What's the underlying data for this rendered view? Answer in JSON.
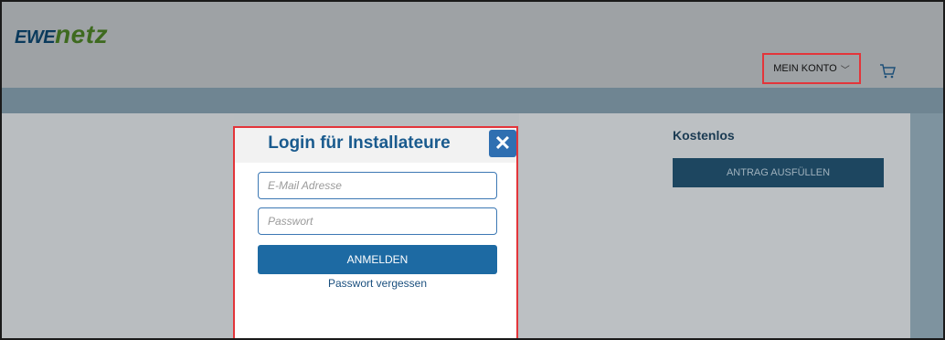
{
  "header": {
    "logo_ewe": "EWE",
    "logo_netz": "netz",
    "account_label": "MEIN KONTO",
    "account_chevron": "chevron-down-icon",
    "cart_icon": "cart-icon"
  },
  "card": {
    "title": "Kostenlos",
    "button_label": "ANTRAG AUSFÜLLEN"
  },
  "modal": {
    "title": "Login für Installateure",
    "close_symbol": "✕",
    "email_placeholder": "E-Mail Adresse",
    "password_placeholder": "Passwort",
    "submit_label": "ANMELDEN",
    "forgot_label": "Passwort vergessen"
  },
  "colors": {
    "accent_red": "#e3353a",
    "primary_blue": "#1d6aa3",
    "title_blue": "#1a5b8e"
  }
}
